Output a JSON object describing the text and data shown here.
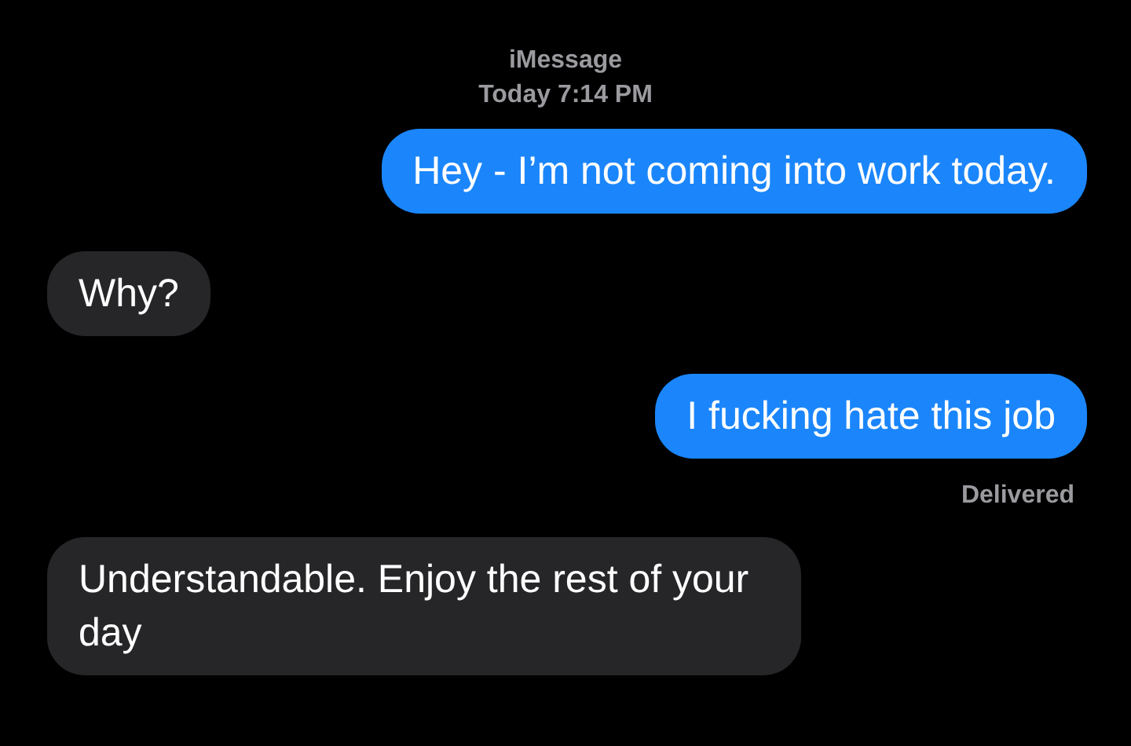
{
  "header": {
    "service": "iMessage",
    "time_prefix": "Today",
    "time": "7:14 PM"
  },
  "messages": [
    {
      "kind": "outgoing",
      "text": "Hey - I’m not coming into work today."
    },
    {
      "kind": "incoming",
      "text": "Why?"
    },
    {
      "kind": "outgoing",
      "text": "I fucking hate this job",
      "status": "Delivered"
    },
    {
      "kind": "incoming",
      "text": "Understandable. Enjoy the rest of your day"
    }
  ]
}
